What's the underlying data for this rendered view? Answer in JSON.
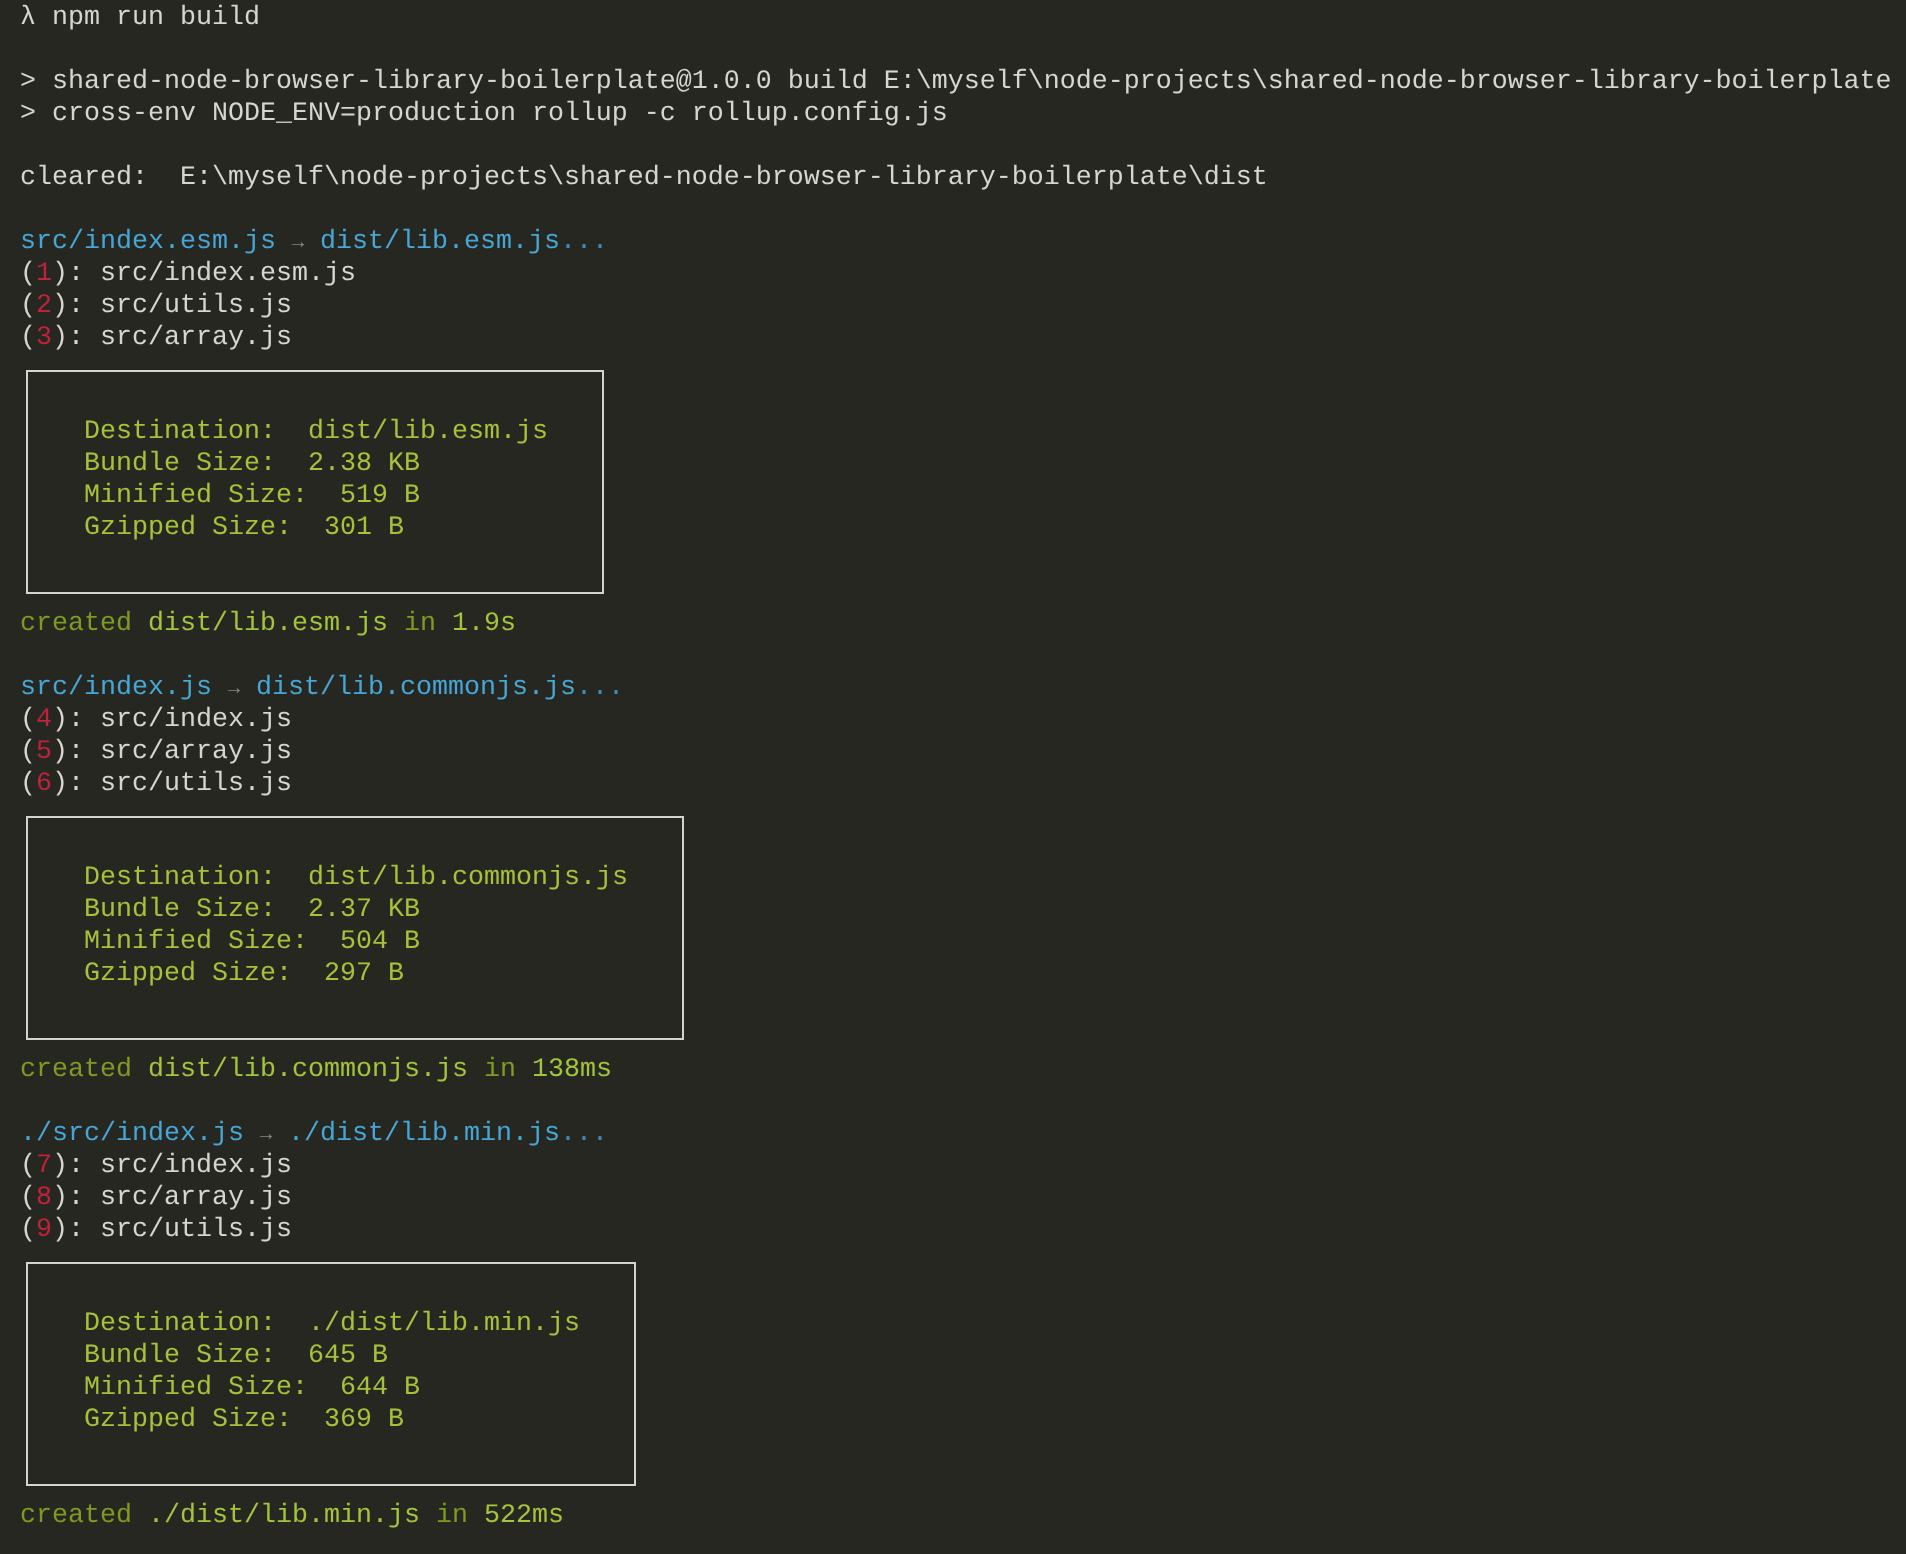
{
  "prompt": {
    "symbol": "λ",
    "command": "npm run build"
  },
  "script_lines": [
    "> shared-node-browser-library-boilerplate@1.0.0 build E:\\myself\\node-projects\\shared-node-browser-library-boilerplate",
    "> cross-env NODE_ENV=production rollup -c rollup.config.js"
  ],
  "cleared": {
    "label": "cleared:",
    "path": "E:\\myself\\node-projects\\shared-node-browser-library-boilerplate\\dist"
  },
  "bundles": [
    {
      "input": "src/index.esm.js",
      "arrow": "→",
      "output": "dist/lib.esm.js",
      "ellipsis": "...",
      "modules": [
        {
          "open": "(",
          "number": "1",
          "close": "):",
          "path": "src/index.esm.js"
        },
        {
          "open": "(",
          "number": "2",
          "close": "):",
          "path": "src/utils.js"
        },
        {
          "open": "(",
          "number": "3",
          "close": "):",
          "path": "src/array.js"
        }
      ],
      "summary": [
        {
          "label": "Destination:",
          "value": "dist/lib.esm.js"
        },
        {
          "label": "Bundle Size:",
          "value": "2.38 KB"
        },
        {
          "label": "Minified Size:",
          "value": "519 B"
        },
        {
          "label": "Gzipped Size:",
          "value": "301 B"
        }
      ],
      "created": {
        "word": "created",
        "target": "dist/lib.esm.js",
        "in": "in",
        "time": "1.9s"
      }
    },
    {
      "input": "src/index.js",
      "arrow": "→",
      "output": "dist/lib.commonjs.js",
      "ellipsis": "...",
      "modules": [
        {
          "open": "(",
          "number": "4",
          "close": "):",
          "path": "src/index.js"
        },
        {
          "open": "(",
          "number": "5",
          "close": "):",
          "path": "src/array.js"
        },
        {
          "open": "(",
          "number": "6",
          "close": "):",
          "path": "src/utils.js"
        }
      ],
      "summary": [
        {
          "label": "Destination:",
          "value": "dist/lib.commonjs.js"
        },
        {
          "label": "Bundle Size:",
          "value": "2.37 KB"
        },
        {
          "label": "Minified Size:",
          "value": "504 B"
        },
        {
          "label": "Gzipped Size:",
          "value": "297 B"
        }
      ],
      "created": {
        "word": "created",
        "target": "dist/lib.commonjs.js",
        "in": "in",
        "time": "138ms"
      }
    },
    {
      "input": "./src/index.js",
      "arrow": "→",
      "output": "./dist/lib.min.js",
      "ellipsis": "...",
      "modules": [
        {
          "open": "(",
          "number": "7",
          "close": "):",
          "path": "src/index.js"
        },
        {
          "open": "(",
          "number": "8",
          "close": "):",
          "path": "src/array.js"
        },
        {
          "open": "(",
          "number": "9",
          "close": "):",
          "path": "src/utils.js"
        }
      ],
      "summary": [
        {
          "label": "Destination:",
          "value": "./dist/lib.min.js"
        },
        {
          "label": "Bundle Size:",
          "value": "645 B"
        },
        {
          "label": "Minified Size:",
          "value": "644 B"
        },
        {
          "label": "Gzipped Size:",
          "value": "369 B"
        }
      ],
      "created": {
        "word": "created",
        "target": "./dist/lib.min.js",
        "in": "in",
        "time": "522ms"
      }
    }
  ]
}
